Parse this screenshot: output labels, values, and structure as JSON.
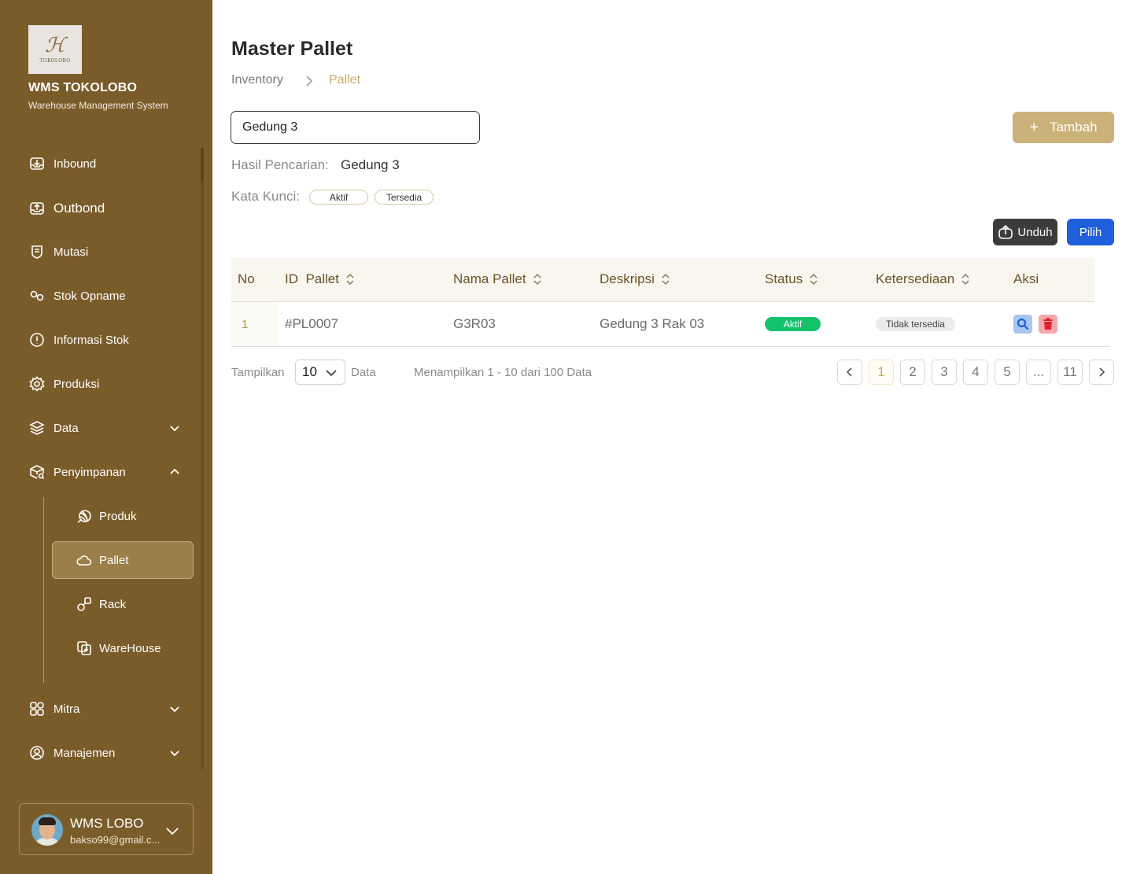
{
  "sidebar": {
    "logo_word": "TOKOLOBO",
    "app_name": "WMS TOKOLOBO",
    "app_sub": "Warehouse Management System",
    "nav": {
      "inbound": "Inbound",
      "outbond": "Outbond",
      "mutasi": "Mutasi",
      "stok_opname": "Stok Opname",
      "informasi_stok": "Informasi Stok",
      "produksi": "Produksi",
      "data": "Data",
      "penyimpanan": "Penyimpanan",
      "mitra": "Mitra",
      "manajemen": "Manajemen"
    },
    "sub": {
      "produk": "Produk",
      "pallet": "Pallet",
      "rack": "Rack",
      "warehouse": "WareHouse"
    },
    "user": {
      "name": "WMS LOBO",
      "email": "bakso99@gmail.c..."
    }
  },
  "main": {
    "title": "Master Pallet",
    "breadcrumb": [
      "Inventory",
      "Pallet"
    ],
    "search_value": "Gedung 3",
    "add_label": "Tambah",
    "result_label": "Hasil Pencarian:",
    "result_value": "Gedung 3",
    "keyword_label": "Kata Kunci:",
    "keywords": [
      "Aktif",
      "Tersedia"
    ],
    "download_label": "Unduh",
    "select_label": "Pilih",
    "table": {
      "headers": [
        "No",
        "ID  Pallet",
        "Nama Pallet",
        "Deskripsi",
        "Status",
        "Ketersediaan",
        "Aksi"
      ],
      "rows": [
        {
          "no": "1",
          "id": "#PL0007",
          "nama": "G3R03",
          "deskripsi": "Gedung 3 Rak 03",
          "status": "Aktif",
          "ketersediaan": "Tidak tersedia"
        }
      ]
    },
    "pagination": {
      "show_label": "Tampilkan",
      "page_size": "10",
      "data_label": "Data",
      "range_text": "Menampilkan 1 - 10 dari 100 Data",
      "pages": [
        "1",
        "2",
        "3",
        "4",
        "5",
        "...",
        "11"
      ],
      "current": "1"
    }
  },
  "colors": {
    "sidebar_bg": "#7a5c2a",
    "accent_gold": "#cbb27a",
    "primary_blue": "#1f5fdc",
    "status_green": "#14c26b",
    "danger_red": "#e0242f"
  }
}
